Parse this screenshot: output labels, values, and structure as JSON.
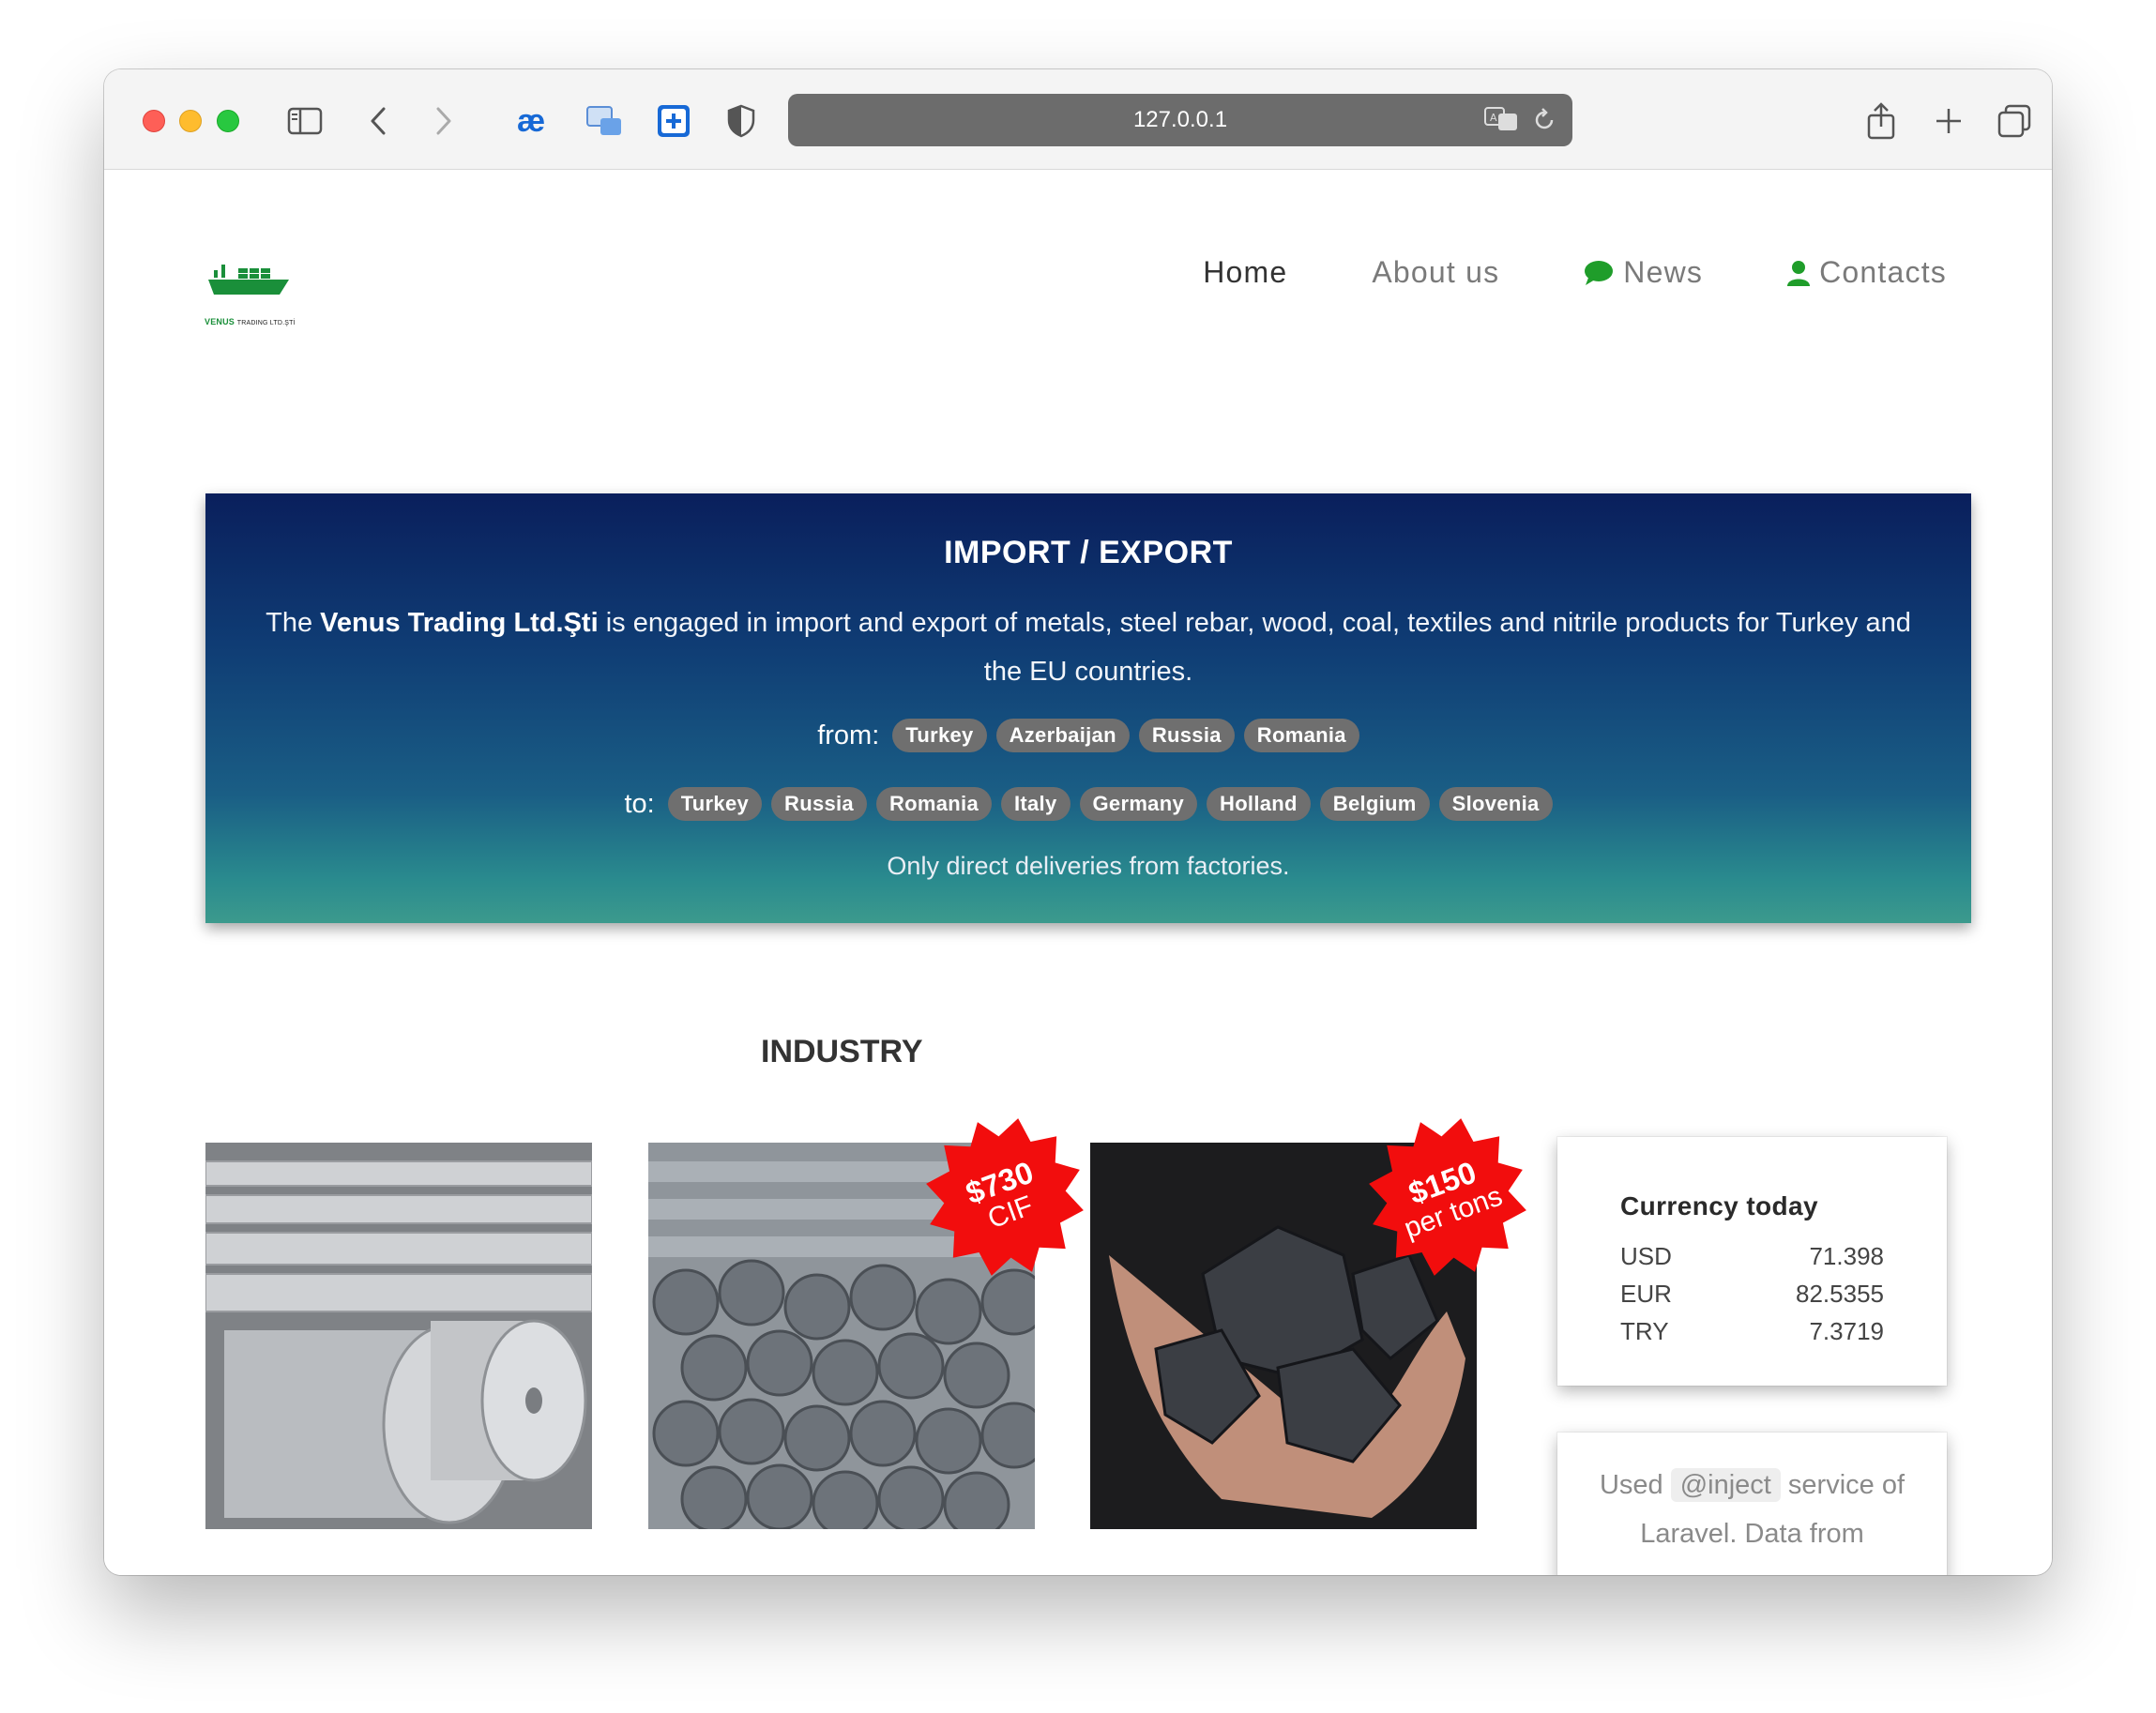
{
  "browser": {
    "url": "127.0.0.1",
    "toolbar_icons": [
      "sidebar-icon",
      "back-icon",
      "forward-icon",
      "ae-extension-icon",
      "pip-extension-icon",
      "plus-box-extension-icon",
      "shield-icon",
      "translate-icon",
      "reload-icon",
      "share-icon",
      "new-tab-icon",
      "tabs-overview-icon"
    ]
  },
  "logo": {
    "brand": "VENUS",
    "suffix": "TRADING LTD.ŞTİ",
    "color": "#1a8f3a"
  },
  "nav": {
    "items": [
      {
        "label": "Home",
        "icon": ""
      },
      {
        "label": "About us",
        "icon": ""
      },
      {
        "label": "News",
        "icon": "comment-icon"
      },
      {
        "label": "Contacts",
        "icon": "user-icon"
      }
    ],
    "icon_color": "#2e8b2e"
  },
  "hero": {
    "title": "IMPORT / EXPORT",
    "desc_before": "The ",
    "company": "Venus Trading Ltd.Şti",
    "desc_after": " is engaged in import and export of metals, steel rebar, wood, coal, textiles and nitrile products for Turkey and the EU countries.",
    "from_label": "from:",
    "from": [
      "Turkey",
      "Azerbaijan",
      "Russia",
      "Romania"
    ],
    "to_label": "to:",
    "to": [
      "Turkey",
      "Russia",
      "Romania",
      "Italy",
      "Germany",
      "Holland",
      "Belgium",
      "Slovenia"
    ],
    "note": "Only direct deliveries from factories."
  },
  "industry": {
    "title": "INDUSTRY",
    "products": [
      {
        "name": "aluminum-coils"
      },
      {
        "name": "steel-rebar",
        "badge_top": "$730",
        "badge_bottom": "CIF"
      },
      {
        "name": "coal",
        "badge_top": "$150",
        "badge_bottom": "per tons"
      }
    ],
    "badge_color": "#f20d0d"
  },
  "currency": {
    "title": "Currency today",
    "rates": [
      {
        "code": "USD",
        "value": "71.398"
      },
      {
        "code": "EUR",
        "value": "82.5355"
      },
      {
        "code": "TRY",
        "value": "7.3719"
      }
    ]
  },
  "inject_card": {
    "before": "Used ",
    "code": "@inject",
    "after": " service of Laravel. Data from"
  }
}
